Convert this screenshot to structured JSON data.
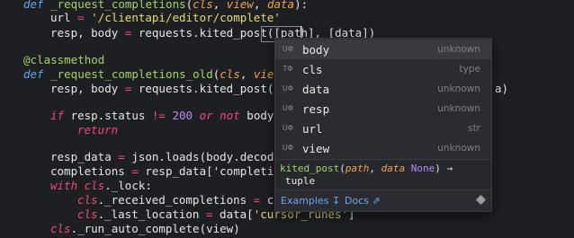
{
  "code": {
    "line1": {
      "kw": "def",
      "fn": "_request_completions",
      "open": "(",
      "p1": "cls",
      "c1": ", ",
      "p2": "view",
      "c2": ", ",
      "p3": "data",
      "close": "):"
    },
    "line2": {
      "a": "url ",
      "op": "=",
      "str": "'/clientapi/editor/complete'"
    },
    "line3": {
      "a": "resp, body ",
      "op": "=",
      "b": " requests.kited_post(",
      "c": "[path]",
      "d": ", [data])"
    },
    "line4": {
      "dec": "@classmethod"
    },
    "line5": {
      "kw": "def",
      "fn": "_request_completions_old",
      "open": "(",
      "p1": "cls",
      "c1": ", ",
      "p2": "view",
      "c2": ","
    },
    "line6": {
      "a": "resp, body ",
      "op": "=",
      "b": " requests.kited_post('/",
      "tail": "a)"
    },
    "line7": {
      "kw1": "if",
      "a": " resp.status ",
      "op": "!=",
      "num": " 200 ",
      "kw2": "or not",
      "b": " body:"
    },
    "line8": {
      "kw": "return"
    },
    "line9": {
      "a": "resp_data ",
      "op": "=",
      "b": " json.loads(body.decode("
    },
    "line10": {
      "a": "completions ",
      "op": "=",
      "b": " resp_data['completion"
    },
    "line11": {
      "kw": "with",
      "self": " cls",
      "b": "._lock:"
    },
    "line12": {
      "self": "cls",
      "b": "._received_completions ",
      "op": "=",
      "c": " com"
    },
    "line13": {
      "self": "cls",
      "b": "._last_location ",
      "op": "=",
      "c": " data[",
      "str": "'cursor_runes'",
      "d": "]"
    },
    "line14": {
      "self": "cls",
      "b": "._run_auto_complete(view)"
    }
  },
  "popup": {
    "items": [
      {
        "icon": "kite-symbol-icon",
        "badge": "UΦ",
        "name": "body",
        "type": "unknown"
      },
      {
        "icon": "kite-type-icon",
        "badge": "TΦ",
        "name": "cls",
        "type": "type"
      },
      {
        "icon": "kite-symbol-icon",
        "badge": "UΦ",
        "name": "data",
        "type": "unknown"
      },
      {
        "icon": "kite-symbol-icon",
        "badge": "UΦ",
        "name": "resp",
        "type": "unknown"
      },
      {
        "icon": "kite-symbol-icon",
        "badge": "UΦ",
        "name": "url",
        "type": "str"
      },
      {
        "icon": "kite-symbol-icon",
        "badge": "UΦ",
        "name": "view",
        "type": "unknown"
      }
    ],
    "signature": {
      "fn": "kited_post",
      "open": "(",
      "p1": "path",
      "c1": ", ",
      "p2": "data",
      "p2_default": " None",
      "close": ") →",
      "returns": "tuple"
    },
    "links": {
      "examples": "Examples ↧",
      "docs": "Docs ⇗"
    },
    "colors": {
      "accent": "#6aa7e8",
      "background": "#2b2c31"
    }
  }
}
